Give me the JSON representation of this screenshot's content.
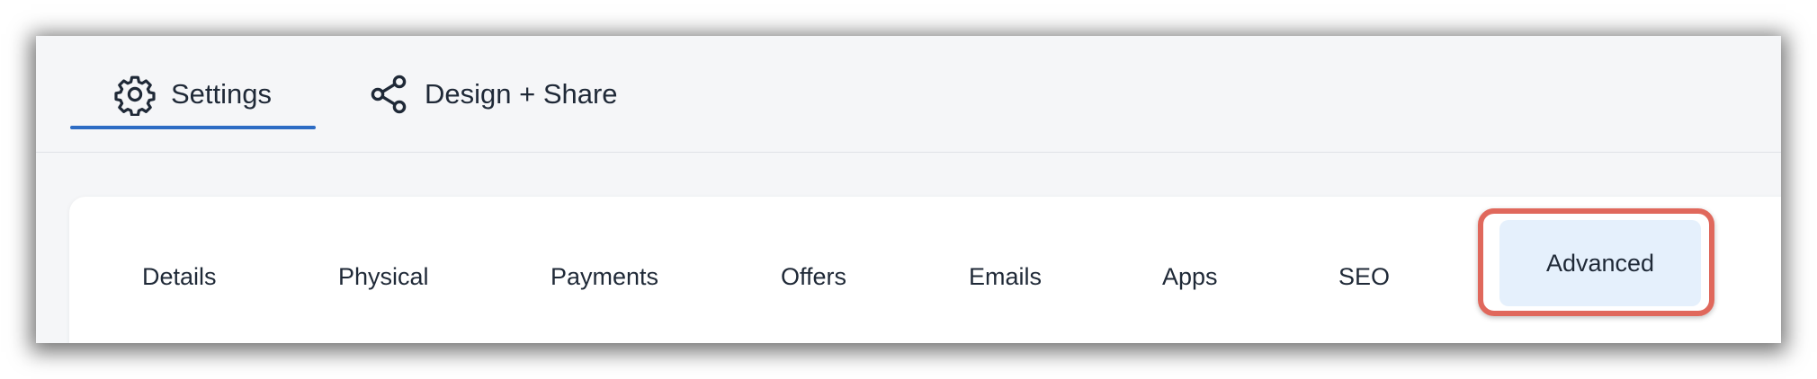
{
  "top_tabs": {
    "settings": {
      "label": "Settings",
      "icon": "gear-icon",
      "active": true
    },
    "design_share": {
      "label": "Design + Share",
      "icon": "share-icon",
      "active": false
    }
  },
  "sub_tabs": [
    {
      "label": "Details"
    },
    {
      "label": "Physical"
    },
    {
      "label": "Payments"
    },
    {
      "label": "Offers"
    },
    {
      "label": "Emails"
    },
    {
      "label": "Apps"
    },
    {
      "label": "SEO"
    },
    {
      "label": "Advanced",
      "selected": true,
      "highlighted": true
    }
  ],
  "colors": {
    "accent": "#2d6cc4",
    "highlight_border": "#e0685c",
    "selected_tab_bg": "#e5f0fc",
    "window_bg": "#f5f6f8"
  }
}
